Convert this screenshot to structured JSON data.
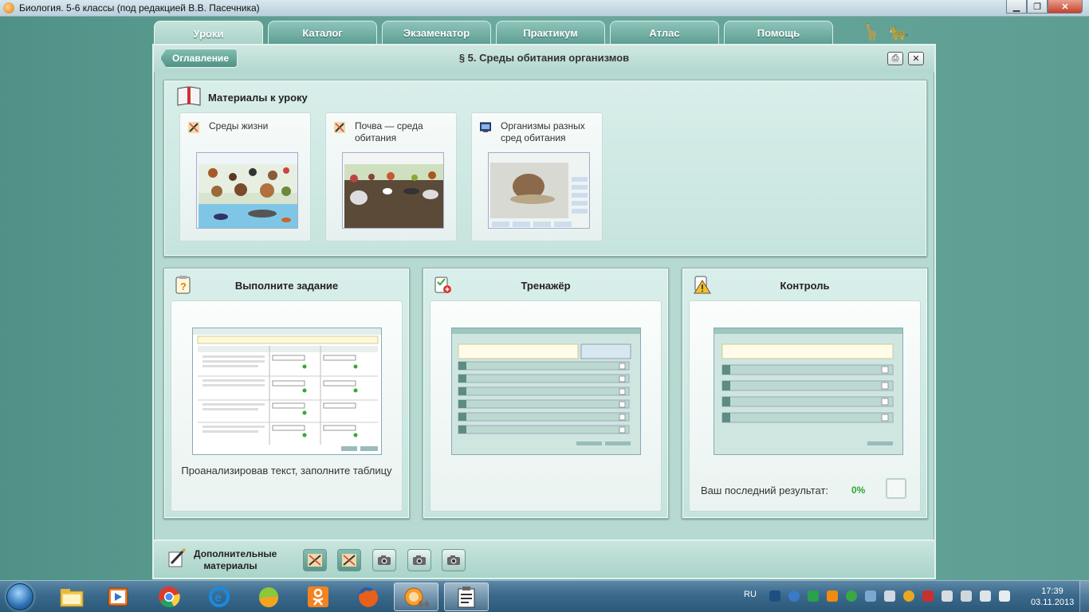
{
  "window": {
    "title": "Биология. 5-6 классы (под редакцией В.В. Пасечника)",
    "minimize": "▁",
    "maximize": "❐",
    "close": "✕"
  },
  "tabs": [
    {
      "label": "Уроки",
      "active": true
    },
    {
      "label": "Каталог"
    },
    {
      "label": "Экзаменатор"
    },
    {
      "label": "Практикум"
    },
    {
      "label": "Атлас"
    },
    {
      "label": "Помощь"
    }
  ],
  "header": {
    "back_label": "Оглавление",
    "title": "§ 5. Среды обитания организмов",
    "print_icon": "printer-icon",
    "close_icon": "close-icon"
  },
  "materials": {
    "title": "Материалы к уроку",
    "cards": [
      {
        "label": "Среды жизни",
        "icon": "pencil-icon"
      },
      {
        "label": "Почва — среда обитания",
        "icon": "pencil-icon"
      },
      {
        "label": "Организмы разных сред обитания",
        "icon": "monitor-icon"
      }
    ]
  },
  "task": {
    "title": "Выполните задание",
    "caption": "Проанализировав текст, заполните таблицу",
    "icon": "question-clipboard-icon"
  },
  "trainer": {
    "title": "Тренажёр",
    "icon": "checklist-icon"
  },
  "control": {
    "title": "Контроль",
    "last_result_label": "Ваш последний результат:",
    "last_result_value": "0%",
    "icon": "warning-icon"
  },
  "extras": {
    "label": "Дополнительные материалы",
    "buttons": [
      "pencil-icon",
      "pencil-icon",
      "camera-icon",
      "camera-icon",
      "camera-icon"
    ]
  },
  "taskbar": {
    "lang": "RU",
    "time": "17:39",
    "date": "03.11.2013",
    "apps": [
      "file-explorer-icon",
      "media-player-icon",
      "chrome-icon",
      "ie-icon",
      "app-icon",
      "odnoklassniki-icon",
      "firefox-icon",
      "biology-app-icon",
      "clipboard-app-icon"
    ]
  },
  "colors": {
    "accent": "#5e9e92",
    "result": "#2fa52f"
  }
}
